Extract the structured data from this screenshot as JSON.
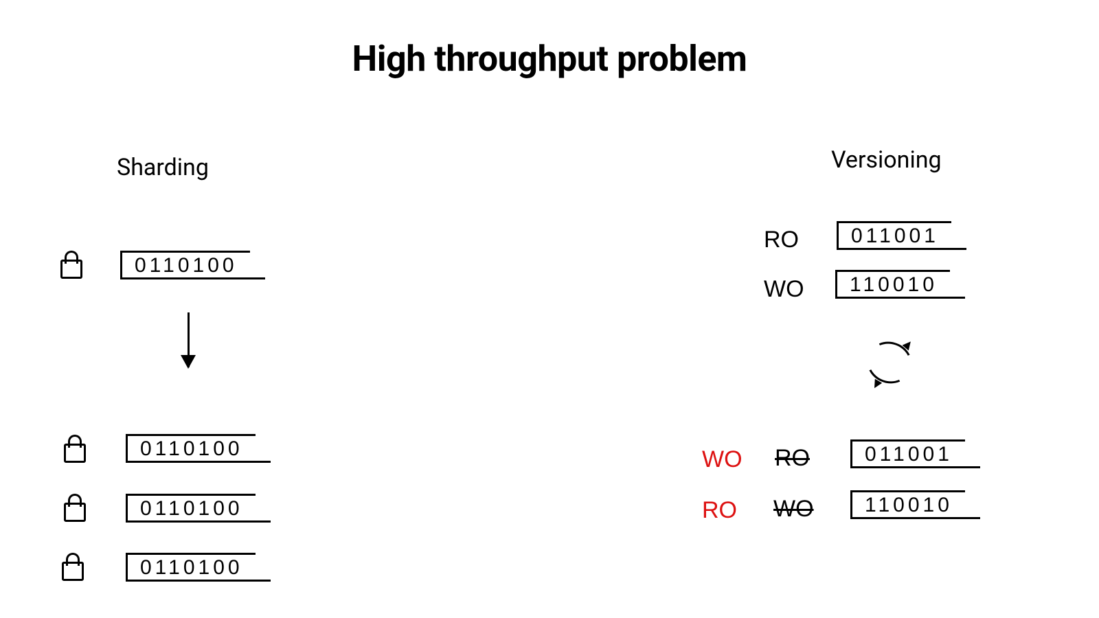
{
  "title": "High throughput problem",
  "sharding": {
    "label": "Sharding",
    "source": "0110100",
    "shards": [
      "0110100",
      "0110100",
      "0110100"
    ]
  },
  "versioning": {
    "label": "Versioning",
    "before": [
      {
        "mode": "RO",
        "data": "011001"
      },
      {
        "mode": "WO",
        "data": "110010"
      }
    ],
    "after": [
      {
        "new_mode": "WO",
        "old_mode": "RO",
        "data": "011001"
      },
      {
        "new_mode": "RO",
        "old_mode": "WO",
        "data": "110010"
      }
    ]
  }
}
